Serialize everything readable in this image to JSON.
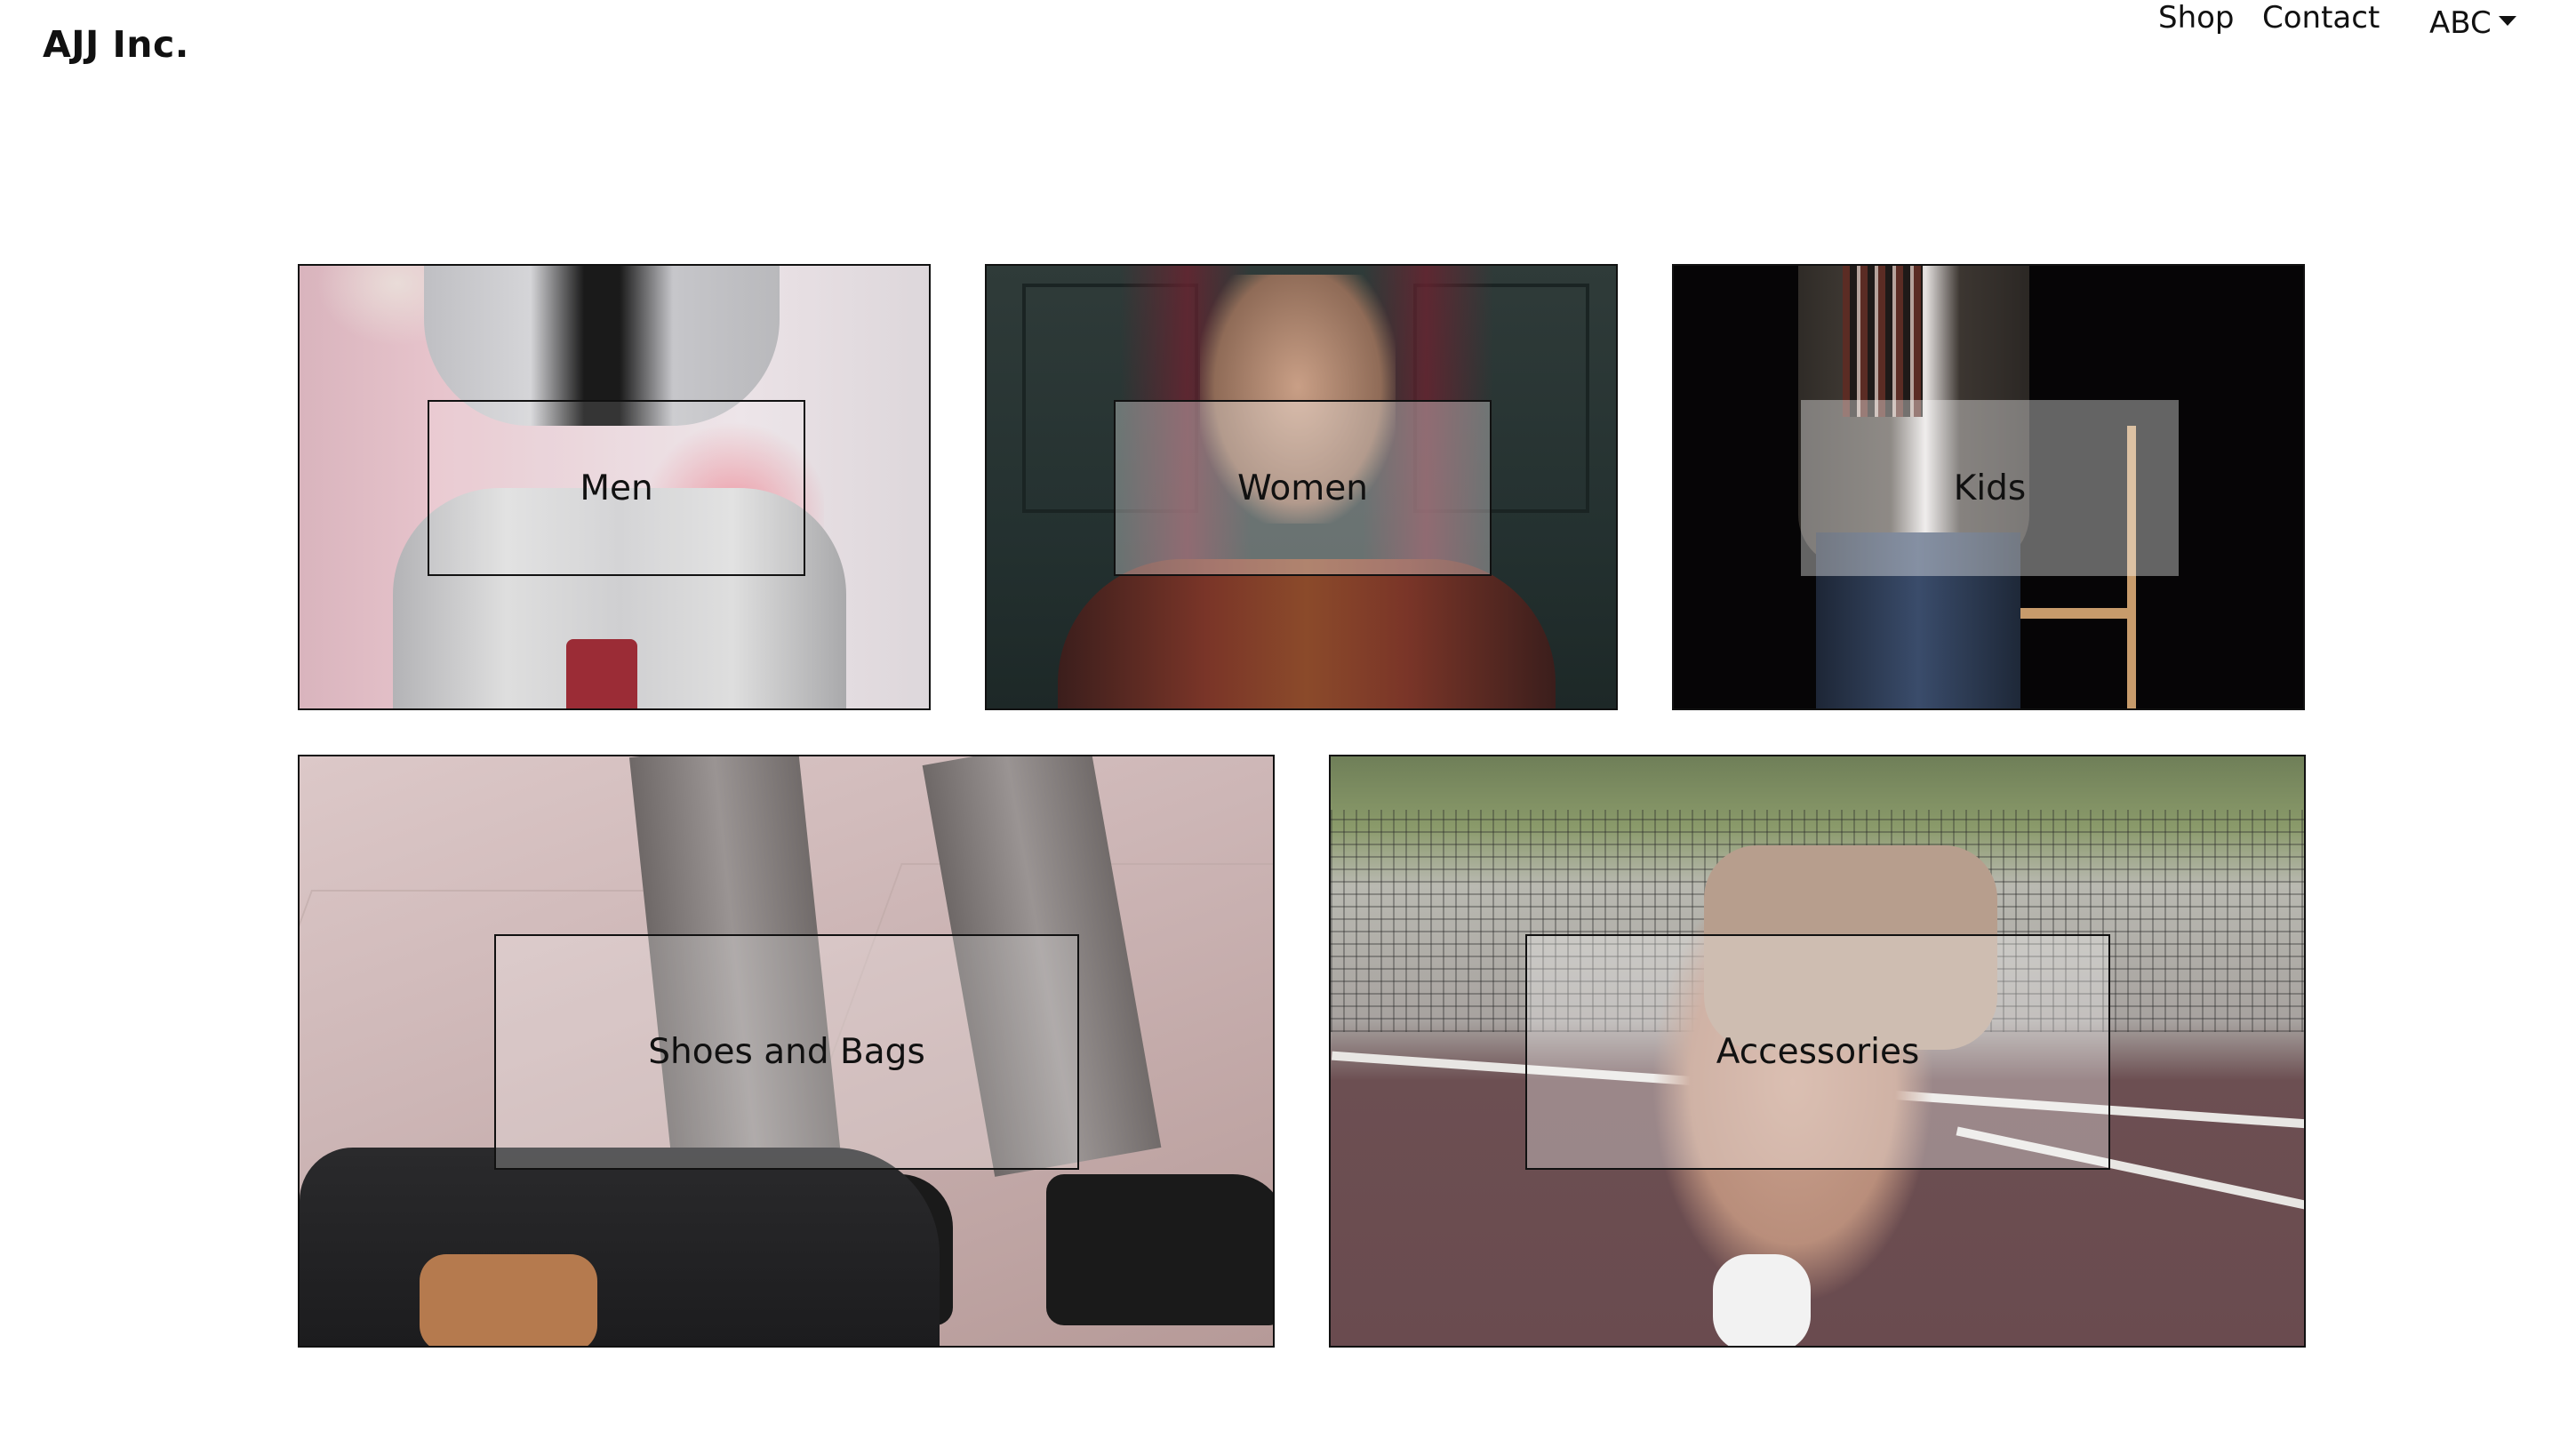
{
  "header": {
    "brand": "AJJ Inc.",
    "nav": [
      {
        "label": "Shop"
      },
      {
        "label": "Contact"
      }
    ],
    "user_menu": {
      "label": "ABC"
    }
  },
  "categories": [
    {
      "label": "Men"
    },
    {
      "label": "Women"
    },
    {
      "label": "Kids"
    },
    {
      "label": "Shoes and Bags"
    },
    {
      "label": "Accessories"
    }
  ]
}
